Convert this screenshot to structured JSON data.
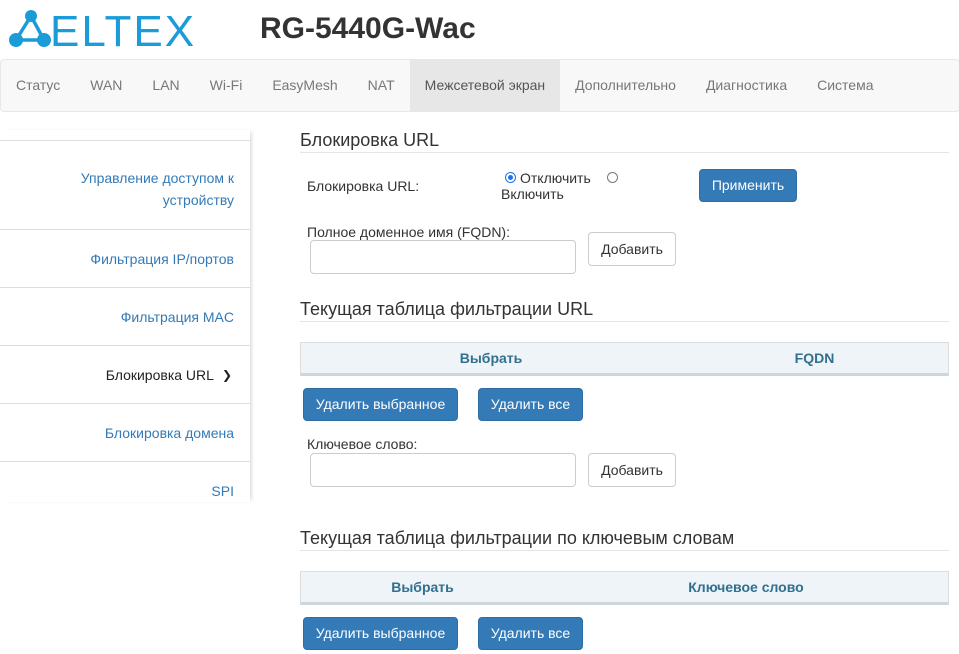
{
  "header": {
    "brand": "ELTEX",
    "model": "RG-5440G-Wac"
  },
  "nav": [
    {
      "label": "Статус",
      "active": false
    },
    {
      "label": "WAN",
      "active": false
    },
    {
      "label": "LAN",
      "active": false
    },
    {
      "label": "Wi-Fi",
      "active": false
    },
    {
      "label": "EasyMesh",
      "active": false
    },
    {
      "label": "NAT",
      "active": false
    },
    {
      "label": "Межсетевой экран",
      "active": true
    },
    {
      "label": "Дополнительно",
      "active": false
    },
    {
      "label": "Диагностика",
      "active": false
    },
    {
      "label": "Система",
      "active": false
    }
  ],
  "sidebar": {
    "items": [
      {
        "label": "Управление доступом к устройству"
      },
      {
        "label": "Фильтрация IP/портов"
      },
      {
        "label": "Фильтрация MAC"
      },
      {
        "label": "Блокировка URL"
      },
      {
        "label": "Блокировка домена"
      },
      {
        "label": "SPI"
      }
    ],
    "active_index": 3
  },
  "url_block": {
    "title": "Блокировка URL",
    "label": "Блокировка URL:",
    "option_off": "Отключить",
    "option_on": "Включить",
    "selected": "Отключить",
    "apply": "Применить",
    "fqdn_label": "Полное доменное имя (FQDN):",
    "fqdn_value": "",
    "add": "Добавить"
  },
  "url_table": {
    "title": "Текущая таблица фильтрации URL",
    "columns": [
      "Выбрать",
      "FQDN"
    ],
    "rows": [],
    "delete_selected": "Удалить выбранное",
    "delete_all": "Удалить все"
  },
  "keyword": {
    "label": "Ключевое слово:",
    "value": "",
    "add": "Добавить"
  },
  "keyword_table": {
    "title": "Текущая таблица фильтрации по ключевым словам",
    "columns": [
      "Выбрать",
      "Ключевое слово"
    ],
    "rows": [],
    "delete_selected": "Удалить выбранное",
    "delete_all": "Удалить все"
  },
  "colors": {
    "brand": "#1b9bd7",
    "primary": "#337ab7",
    "link": "#337ab7",
    "table_header_text": "#31708f"
  }
}
